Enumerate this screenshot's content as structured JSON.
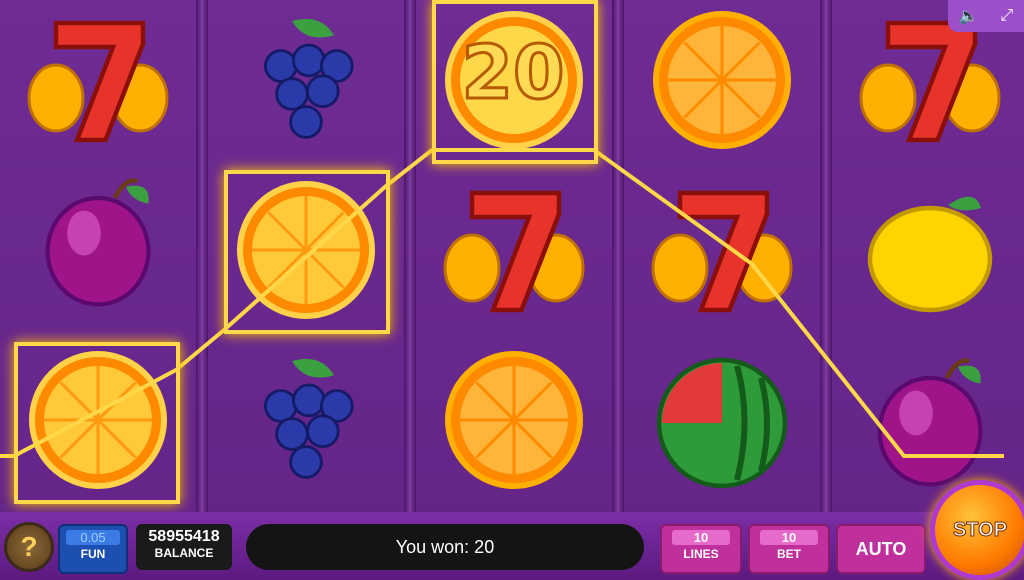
{
  "game": {
    "win_amount_overlay": "20",
    "message": "You won: 20"
  },
  "symbols": {
    "reel1": [
      "seven",
      "plum",
      "orange"
    ],
    "reel2": [
      "grapes",
      "orange",
      "grapes"
    ],
    "reel3": [
      "orange",
      "seven",
      "orange"
    ],
    "reel4": [
      "orange",
      "seven",
      "watermelon"
    ],
    "reel5": [
      "seven",
      "lemon",
      "plum"
    ]
  },
  "panel": {
    "help_label": "?",
    "fun_value": "0.05",
    "fun_label": "FUN",
    "balance_value": "58955418",
    "balance_label": "BALANCE",
    "lines_value": "10",
    "lines_label": "LINES",
    "bet_value": "10",
    "bet_label": "BET",
    "auto_label": "AUTO",
    "stop_label": "STOP"
  },
  "topbar": {
    "sound_icon": "speaker-icon",
    "fullscreen_icon": "fullscreen-icon"
  },
  "colors": {
    "background": "#5a1e7a",
    "win_highlight": "#ffd84a",
    "button_magenta": "#c0309c",
    "fun_blue": "#1d4fb0",
    "stop_orange": "#ff7a00"
  }
}
